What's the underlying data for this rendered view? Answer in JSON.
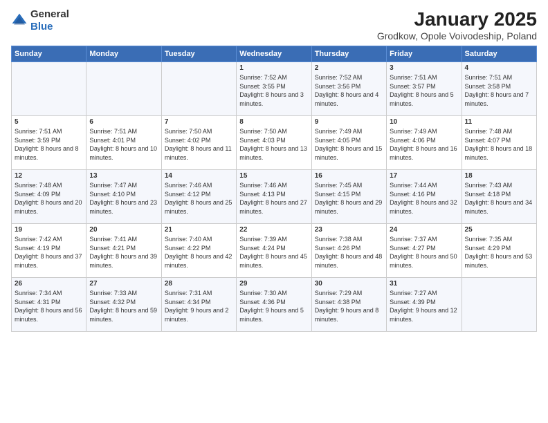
{
  "header": {
    "logo_general": "General",
    "logo_blue": "Blue",
    "title": "January 2025",
    "subtitle": "Grodkow, Opole Voivodeship, Poland"
  },
  "columns": [
    "Sunday",
    "Monday",
    "Tuesday",
    "Wednesday",
    "Thursday",
    "Friday",
    "Saturday"
  ],
  "weeks": [
    [
      {
        "day": "",
        "text": ""
      },
      {
        "day": "",
        "text": ""
      },
      {
        "day": "",
        "text": ""
      },
      {
        "day": "1",
        "text": "Sunrise: 7:52 AM\nSunset: 3:55 PM\nDaylight: 8 hours and 3 minutes."
      },
      {
        "day": "2",
        "text": "Sunrise: 7:52 AM\nSunset: 3:56 PM\nDaylight: 8 hours and 4 minutes."
      },
      {
        "day": "3",
        "text": "Sunrise: 7:51 AM\nSunset: 3:57 PM\nDaylight: 8 hours and 5 minutes."
      },
      {
        "day": "4",
        "text": "Sunrise: 7:51 AM\nSunset: 3:58 PM\nDaylight: 8 hours and 7 minutes."
      }
    ],
    [
      {
        "day": "5",
        "text": "Sunrise: 7:51 AM\nSunset: 3:59 PM\nDaylight: 8 hours and 8 minutes."
      },
      {
        "day": "6",
        "text": "Sunrise: 7:51 AM\nSunset: 4:01 PM\nDaylight: 8 hours and 10 minutes."
      },
      {
        "day": "7",
        "text": "Sunrise: 7:50 AM\nSunset: 4:02 PM\nDaylight: 8 hours and 11 minutes."
      },
      {
        "day": "8",
        "text": "Sunrise: 7:50 AM\nSunset: 4:03 PM\nDaylight: 8 hours and 13 minutes."
      },
      {
        "day": "9",
        "text": "Sunrise: 7:49 AM\nSunset: 4:05 PM\nDaylight: 8 hours and 15 minutes."
      },
      {
        "day": "10",
        "text": "Sunrise: 7:49 AM\nSunset: 4:06 PM\nDaylight: 8 hours and 16 minutes."
      },
      {
        "day": "11",
        "text": "Sunrise: 7:48 AM\nSunset: 4:07 PM\nDaylight: 8 hours and 18 minutes."
      }
    ],
    [
      {
        "day": "12",
        "text": "Sunrise: 7:48 AM\nSunset: 4:09 PM\nDaylight: 8 hours and 20 minutes."
      },
      {
        "day": "13",
        "text": "Sunrise: 7:47 AM\nSunset: 4:10 PM\nDaylight: 8 hours and 23 minutes."
      },
      {
        "day": "14",
        "text": "Sunrise: 7:46 AM\nSunset: 4:12 PM\nDaylight: 8 hours and 25 minutes."
      },
      {
        "day": "15",
        "text": "Sunrise: 7:46 AM\nSunset: 4:13 PM\nDaylight: 8 hours and 27 minutes."
      },
      {
        "day": "16",
        "text": "Sunrise: 7:45 AM\nSunset: 4:15 PM\nDaylight: 8 hours and 29 minutes."
      },
      {
        "day": "17",
        "text": "Sunrise: 7:44 AM\nSunset: 4:16 PM\nDaylight: 8 hours and 32 minutes."
      },
      {
        "day": "18",
        "text": "Sunrise: 7:43 AM\nSunset: 4:18 PM\nDaylight: 8 hours and 34 minutes."
      }
    ],
    [
      {
        "day": "19",
        "text": "Sunrise: 7:42 AM\nSunset: 4:19 PM\nDaylight: 8 hours and 37 minutes."
      },
      {
        "day": "20",
        "text": "Sunrise: 7:41 AM\nSunset: 4:21 PM\nDaylight: 8 hours and 39 minutes."
      },
      {
        "day": "21",
        "text": "Sunrise: 7:40 AM\nSunset: 4:22 PM\nDaylight: 8 hours and 42 minutes."
      },
      {
        "day": "22",
        "text": "Sunrise: 7:39 AM\nSunset: 4:24 PM\nDaylight: 8 hours and 45 minutes."
      },
      {
        "day": "23",
        "text": "Sunrise: 7:38 AM\nSunset: 4:26 PM\nDaylight: 8 hours and 48 minutes."
      },
      {
        "day": "24",
        "text": "Sunrise: 7:37 AM\nSunset: 4:27 PM\nDaylight: 8 hours and 50 minutes."
      },
      {
        "day": "25",
        "text": "Sunrise: 7:35 AM\nSunset: 4:29 PM\nDaylight: 8 hours and 53 minutes."
      }
    ],
    [
      {
        "day": "26",
        "text": "Sunrise: 7:34 AM\nSunset: 4:31 PM\nDaylight: 8 hours and 56 minutes."
      },
      {
        "day": "27",
        "text": "Sunrise: 7:33 AM\nSunset: 4:32 PM\nDaylight: 8 hours and 59 minutes."
      },
      {
        "day": "28",
        "text": "Sunrise: 7:31 AM\nSunset: 4:34 PM\nDaylight: 9 hours and 2 minutes."
      },
      {
        "day": "29",
        "text": "Sunrise: 7:30 AM\nSunset: 4:36 PM\nDaylight: 9 hours and 5 minutes."
      },
      {
        "day": "30",
        "text": "Sunrise: 7:29 AM\nSunset: 4:38 PM\nDaylight: 9 hours and 8 minutes."
      },
      {
        "day": "31",
        "text": "Sunrise: 7:27 AM\nSunset: 4:39 PM\nDaylight: 9 hours and 12 minutes."
      },
      {
        "day": "",
        "text": ""
      }
    ]
  ]
}
